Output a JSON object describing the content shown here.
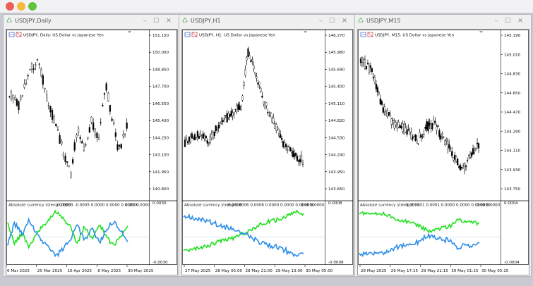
{
  "windows": [
    {
      "title": "USDJPY,Daily",
      "info": "USDJPY, Daily:  US Dollar vs Japanese Yen",
      "indicator": "Absolute currency streng",
      "indicator_values": "0.0003 -0.0005 0.0000 0.0000 0.0000 0.0000",
      "indicator_red": "0.0003",
      "indicator_blue": "0.0000",
      "price_ticks": [
        "151.150",
        "150.000",
        "148.850",
        "147.700",
        "146.550",
        "145.400",
        "144.250",
        "143.100",
        "141.950",
        "140.800"
      ],
      "ind_top": "0.0030",
      "ind_bottom": "-0.0030",
      "time_ticks": [
        "6 Mar 2025",
        "25 Mar 2025",
        "16 Apr 2025",
        "8 May 2025",
        "30 May 2025"
      ]
    },
    {
      "title": "USDJPY,H1",
      "info": "USDJPY, H1:  US Dollar vs Japanese Yen",
      "indicator": "Absolute currency streng",
      "indicator_values": "0.0006 0.0006 0.0000 0.0000 0.0000 0.0000",
      "indicator_red": "-0.0006",
      "indicator_blue": "0.0000",
      "price_ticks": [
        "146.270",
        "145.980",
        "145.690",
        "145.400",
        "145.110",
        "144.820",
        "144.530",
        "144.240",
        "143.950",
        "143.660"
      ],
      "ind_top": "0.0008",
      "ind_bottom": "-0.0008",
      "time_ticks": [
        "27 May 2025",
        "28 May 05:00",
        "28 May 21:00",
        "29 May 13:00",
        "30 May 05:00"
      ]
    },
    {
      "title": "USDJPY,M15",
      "info": "USDJPY, M15:  US Dollar vs Japanese Yen",
      "indicator": "Absolute currency streng",
      "indicator_values": "0.0001 0.0001 0.0000 0.0000 0.0000 0.0000",
      "indicator_red": "-0.0001",
      "indicator_blue": "0.0000",
      "price_ticks": [
        "145.190",
        "145.010",
        "144.830",
        "144.650",
        "144.470",
        "144.290",
        "144.110",
        "143.930",
        "143.750"
      ],
      "ind_top": "0.0004",
      "ind_bottom": "-0.0004",
      "time_ticks": [
        "29 May 2025",
        "29 May 17:15",
        "29 May 21:15",
        "30 May 01:15",
        "30 May 05:15"
      ]
    }
  ],
  "colors": {
    "green_line": "#1fe01f",
    "blue_line": "#2e8fe8",
    "red_text": "#e02020",
    "blue_text": "#2e8fe8",
    "zero_line": "#b8d8f0"
  },
  "icons": [
    "chart-type-icon",
    "grid-icon",
    "minimize-icon",
    "maximize-icon",
    "close-icon"
  ]
}
